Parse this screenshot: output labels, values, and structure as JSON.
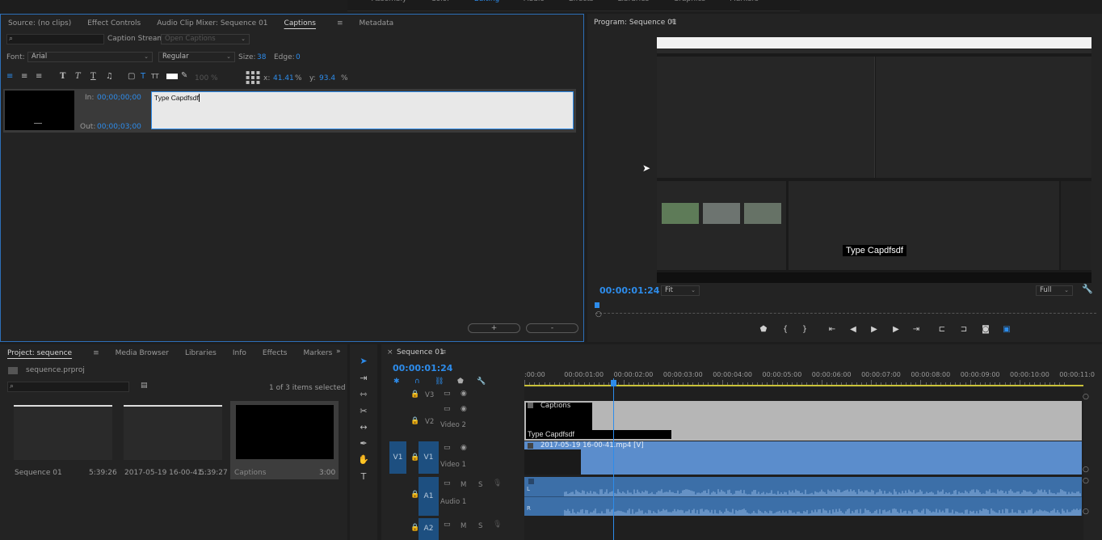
{
  "workspace_tabs": [
    "Assembly",
    "Color",
    "Editing",
    "Audio",
    "Effects",
    "Libraries",
    "Graphics",
    "Markers"
  ],
  "source_panel": {
    "tabs": [
      "Source: (no clips)",
      "Effect Controls",
      "Audio Clip Mixer: Sequence 01",
      "Captions",
      "Metadata"
    ],
    "active_tab": "Captions"
  },
  "captions": {
    "stream_label": "Caption Stream:",
    "stream_value": "Open Captions",
    "font_label": "Font:",
    "font_value": "Arial",
    "style_value": "Regular",
    "size_label": "Size:",
    "size_value": "38",
    "edge_label": "Edge:",
    "edge_value": "0",
    "opacity_value": "100",
    "opacity_unit": "%",
    "x_label": "x:",
    "x_value": "41.41",
    "y_label": "y:",
    "y_value": "93.4",
    "unit": "%",
    "in_label": "In:",
    "in_value": "00;00;00;00",
    "out_label": "Out:",
    "out_value": "00;00;03;00",
    "caption_text": "Type Capdfsdf",
    "add_label": "+",
    "remove_label": "-"
  },
  "program": {
    "title": "Program: Sequence 01",
    "timecode": "00:00:01:24",
    "fit": "Fit",
    "quality": "Full",
    "caption_overlay": "Type Capdfsdf"
  },
  "project": {
    "tabs": [
      "Project: sequence",
      "Media Browser",
      "Libraries",
      "Info",
      "Effects",
      "Markers"
    ],
    "file": "sequence.prproj",
    "selected_count": "1 of 3 items selected",
    "items": [
      {
        "name": "Sequence 01",
        "duration": "5:39:26"
      },
      {
        "name": "2017-05-19 16-00-41....",
        "duration": "5:39:27"
      },
      {
        "name": "Captions",
        "duration": "3:00"
      }
    ]
  },
  "timeline": {
    "tab": "Sequence 01",
    "timecode": "00:00:01:24",
    "ruler": [
      ":00:00",
      "00:00:01:00",
      "00:00:02:00",
      "00:00:03:00",
      "00:00:04:00",
      "00:00:05:00",
      "00:00:06:00",
      "00:00:07:00",
      "00:00:08:00",
      "00:00:09:00",
      "00:00:10:00",
      "00:00:11:0"
    ],
    "tracks": {
      "v3": "V3",
      "v2": "V2",
      "v2_name": "Video 2",
      "v1_src": "V1",
      "v1": "V1",
      "v1_name": "Video 1",
      "a1": "A1",
      "a1_name": "Audio 1",
      "a2": "A2",
      "m": "M",
      "s": "S"
    },
    "captions_clip": "Captions",
    "captions_clip_text": "Type Capdfsdf",
    "video_clip": "2017-05-19 16-00-41.mp4 [V]",
    "audio_l": "L",
    "audio_r": "R"
  },
  "colors": {
    "accent": "#2d8ceb",
    "audio_clip": "#3c6fa8",
    "video_clip": "#5b8dcc",
    "caption_clip": "#b6b6b6"
  }
}
